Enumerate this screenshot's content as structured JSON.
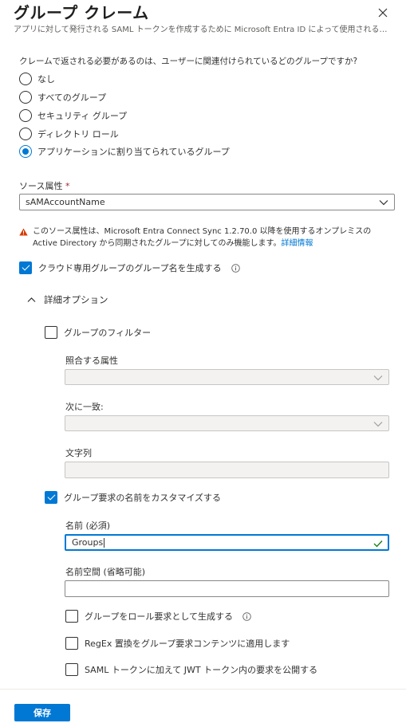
{
  "panel": {
    "title": "グループ クレーム",
    "subtitle": "アプリに対して発行される SAML トークンを作成するために Microsoft Entra ID によって使用される要求の名前と値を管理します。"
  },
  "question": "クレームで返される必要があるのは、ユーザーに関連付けられているどのグループですか?",
  "radios": [
    {
      "label": "なし",
      "checked": false
    },
    {
      "label": "すべてのグループ",
      "checked": false
    },
    {
      "label": "セキュリティ グループ",
      "checked": false
    },
    {
      "label": "ディレクトリ ロール",
      "checked": false
    },
    {
      "label": "アプリケーションに割り当てられているグループ",
      "checked": true
    }
  ],
  "source_attribute": {
    "label": "ソース属性",
    "required_mark": "*",
    "value": "sAMAccountName"
  },
  "warning": {
    "text": "このソース属性は、Microsoft Entra Connect Sync 1.2.70.0 以降を使用するオンプレミスの Active Directory から同期されたグループに対してのみ機能します。",
    "link": "詳細情報"
  },
  "cloud_only_checkbox": {
    "label": "クラウド専用グループのグループ名を生成する",
    "checked": true
  },
  "advanced": {
    "label": "詳細オプション",
    "expanded": true,
    "filter_groups": {
      "label": "グループのフィルター",
      "checked": false
    },
    "match_attribute_label": "照合する属性",
    "match_with_label": "次に一致:",
    "string_label": "文字列",
    "customize_name": {
      "label": "グループ要求の名前をカスタマイズする",
      "checked": true
    },
    "name_label": "名前 (必須)",
    "name_value": "Groups",
    "namespace_label": "名前空間 (省略可能)",
    "namespace_value": "",
    "emit_as_role": {
      "label": "グループをロール要求として生成する",
      "checked": false
    },
    "regex": {
      "label": "RegEx 置換をグループ要求コンテンツに適用します",
      "checked": false
    },
    "jwt": {
      "label": "SAML トークンに加えて JWT トークン内の要求を公開する",
      "checked": false
    }
  },
  "footer": {
    "save_label": "保存"
  },
  "colors": {
    "accent": "#0078d4",
    "warning": "#d83b01",
    "text": "#323130"
  }
}
